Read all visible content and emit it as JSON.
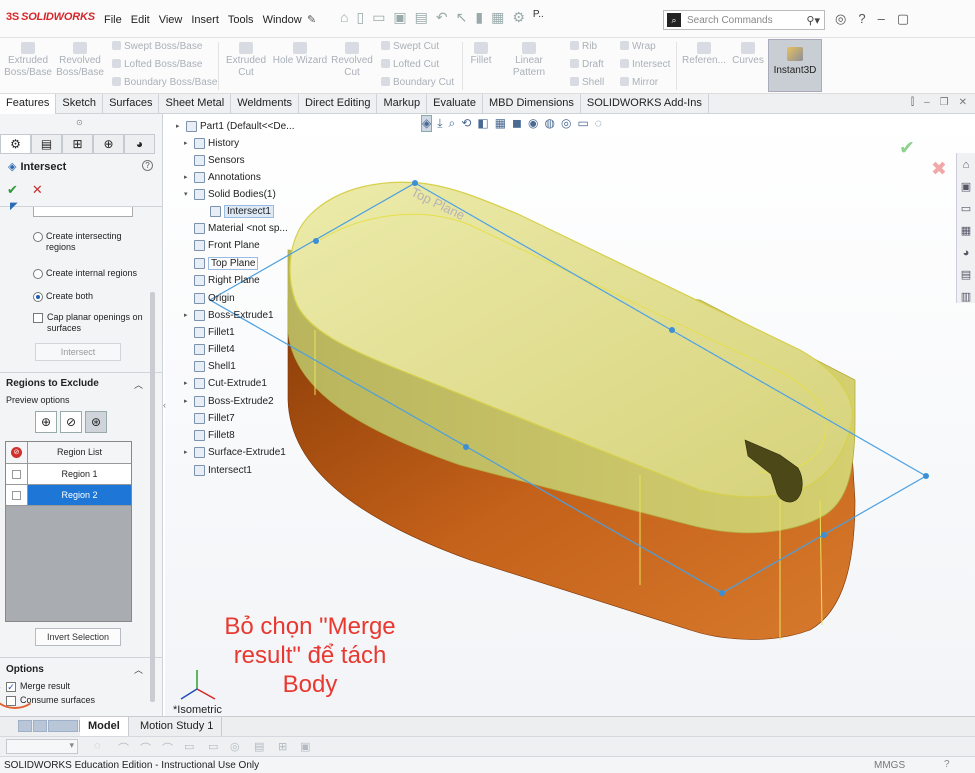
{
  "app": {
    "logo_text": "SOLIDWORKS",
    "logo_mark": "3S"
  },
  "menu": [
    "File",
    "Edit",
    "View",
    "Insert",
    "Tools",
    "Window"
  ],
  "toolbar_overflow": "P..",
  "search": {
    "placeholder": "Search Commands"
  },
  "ribbon": {
    "extruded_boss": "Extruded\nBoss/Base",
    "revolved_boss": "Revolved\nBoss/Base",
    "swept_boss": "Swept Boss/Base",
    "lofted_boss": "Lofted Boss/Base",
    "boundary_boss": "Boundary Boss/Base",
    "extruded_cut": "Extruded\nCut",
    "hole_wizard": "Hole Wizard",
    "revolved_cut": "Revolved\nCut",
    "swept_cut": "Swept Cut",
    "lofted_cut": "Lofted Cut",
    "boundary_cut": "Boundary Cut",
    "fillet": "Fillet",
    "linear_pattern": "Linear Pattern",
    "rib": "Rib",
    "draft": "Draft",
    "shell": "Shell",
    "wrap": "Wrap",
    "intersect": "Intersect",
    "mirror": "Mirror",
    "reference": "Referen...",
    "curves": "Curves",
    "instant3d": "Instant3D"
  },
  "tabs": [
    "Features",
    "Sketch",
    "Surfaces",
    "Sheet Metal",
    "Weldments",
    "Direct Editing",
    "Markup",
    "Evaluate",
    "MBD Dimensions",
    "SOLIDWORKS Add-Ins"
  ],
  "property_manager": {
    "title": "Intersect",
    "help": "?",
    "ok": "✔",
    "cancel": "✕",
    "opt_intersecting": "Create intersecting regions",
    "opt_internal": "Create internal regions",
    "opt_both": "Create both",
    "cap_planar": "Cap planar openings on surfaces",
    "intersect_btn": "Intersect",
    "regions_title": "Regions to Exclude",
    "preview_options": "Preview options",
    "region_list_header": "Region List",
    "regions": [
      "Region 1",
      "Region 2"
    ],
    "invert_selection": "Invert Selection",
    "options_title": "Options",
    "merge_result": "Merge result",
    "consume_surfaces": "Consume surfaces"
  },
  "tree": {
    "root": "Part1  (Default<<De...",
    "history": "History",
    "sensors": "Sensors",
    "annotations": "Annotations",
    "solid_bodies": "Solid Bodies(1)",
    "intersect_body": "Intersect1",
    "material": "Material <not sp...",
    "front_plane": "Front Plane",
    "top_plane": "Top Plane",
    "right_plane": "Right Plane",
    "origin": "Origin",
    "boss_extrude1": "Boss-Extrude1",
    "fillet1": "Fillet1",
    "fillet4": "Fillet4",
    "shell1": "Shell1",
    "cut_extrude1": "Cut-Extrude1",
    "boss_extrude2": "Boss-Extrude2",
    "fillet7": "Fillet7",
    "fillet8": "Fillet8",
    "surface_extrude1": "Surface-Extrude1",
    "intersect1": "Intersect1"
  },
  "viewport": {
    "plane_label": "Top Plane",
    "view_name": "*Isometric",
    "annotation_line1": "Bỏ chọn \"Merge",
    "annotation_line2": "result\" để tách",
    "annotation_line3": "Body",
    "annotation_color": "#e8382f",
    "body_top_color": "#e3e08a",
    "body_bottom_color": "#c9651a"
  },
  "bottom_tabs": {
    "model": "Model",
    "motion": "Motion Study 1"
  },
  "status": {
    "text": "SOLIDWORKS Education Edition - Instructional Use Only",
    "units": "MMGS",
    "help": "?"
  }
}
